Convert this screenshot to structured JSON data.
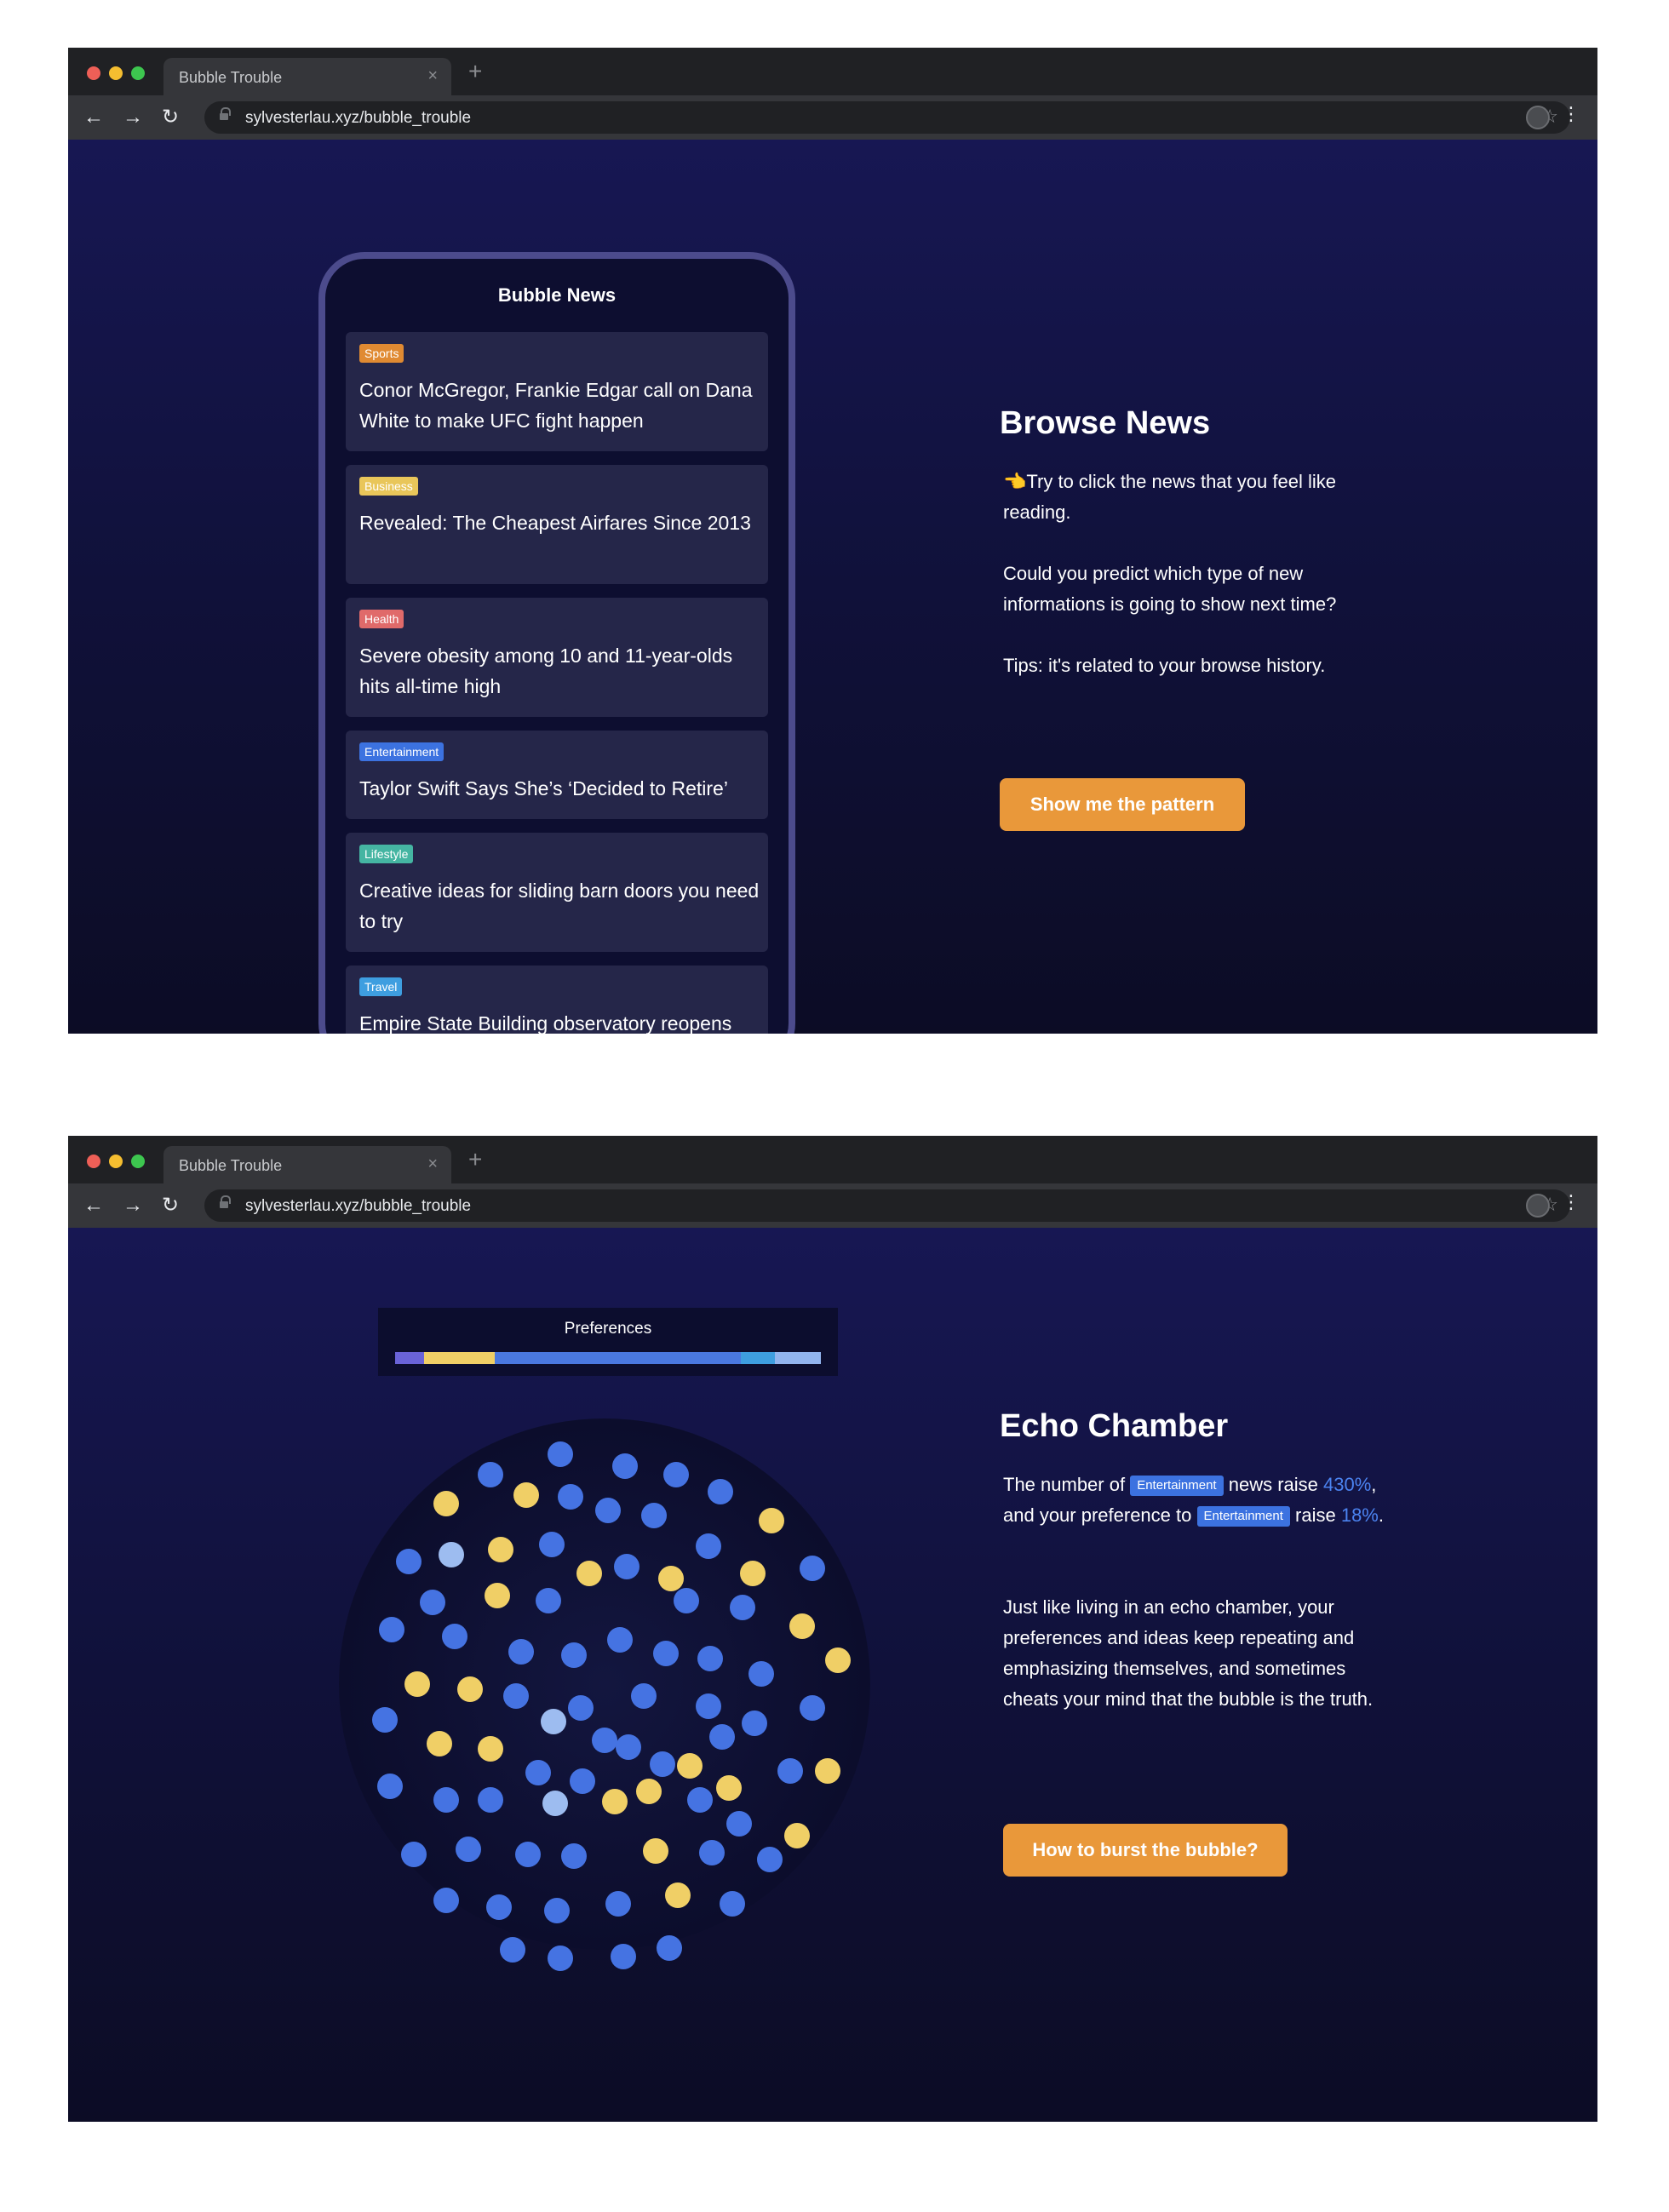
{
  "browser": {
    "tab_title": "Bubble Trouble",
    "url": "sylvesterlau.xyz/bubble_trouble",
    "nav_back": "←",
    "nav_forward": "→",
    "nav_reload": "↻",
    "tab_close": "×",
    "new_tab": "+",
    "star": "☆",
    "menu": "⋮"
  },
  "screen1": {
    "phone": {
      "title": "Bubble News",
      "cards": [
        {
          "tag": "Sports",
          "tag_color": "#e08a32",
          "text": "Conor McGregor, Frankie Edgar call on Dana White to make UFC fight happen"
        },
        {
          "tag": "Business",
          "tag_color": "#e9c65a",
          "text": "Revealed: The Cheapest Airfares Since 2013"
        },
        {
          "tag": "Health",
          "tag_color": "#e06a6a",
          "text": "Severe obesity among 10 and 11-year-olds hits all-time high"
        },
        {
          "tag": "Entertainment",
          "tag_color": "#3c72e0",
          "text": "Taylor Swift Says She’s ‘Decided to Retire’"
        },
        {
          "tag": "Lifestyle",
          "tag_color": "#45b5a2",
          "text": "Creative ideas for sliding barn doors you need to try"
        },
        {
          "tag": "Travel",
          "tag_color": "#3e9ee0",
          "text": "Empire State Building observatory reopens"
        }
      ]
    },
    "title": "Browse News",
    "para1_emoji": "👈",
    "para1": "Try to click the news that you feel like reading.",
    "para2": "Could you predict which type of new informations is going to show next time?",
    "para3": "Tips: it's related to your browse history.",
    "button": "Show me the pattern"
  },
  "screen2": {
    "prefs_title": "Preferences",
    "prefs_segments": [
      {
        "color": "#6a63d8",
        "share": 0.067
      },
      {
        "color": "#f0cf66",
        "share": 0.167
      },
      {
        "color": "#4a78e0",
        "share": 0.577
      },
      {
        "color": "#3e9ee0",
        "share": 0.08
      },
      {
        "color": "#92b4ee",
        "share": 0.109
      }
    ],
    "title": "Echo Chamber",
    "p1_a": "The number of",
    "chip_label": "Entertainment",
    "p1_b": "news raise",
    "pct_news": "430%",
    "p1_c": ", and your preference to",
    "p1_d": "raise",
    "pct_pref": "18%",
    "p1_e": ".",
    "para2": "Just like living in an echo chamber, your preferences and ideas keep repeating and emphasizing themselves, and sometimes cheats your mind that the bubble is the truth.",
    "button": "How to burst the bubble?",
    "bubble_colors": {
      "blue": "#4573e2",
      "yellow": "#f0cf66",
      "light": "#9dbcf0"
    }
  }
}
